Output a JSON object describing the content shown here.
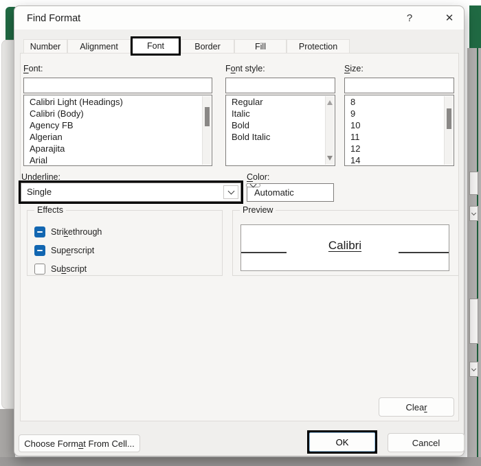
{
  "window": {
    "title": "Find Format",
    "help_icon": "?",
    "close_icon": "✕"
  },
  "tabs": {
    "items": [
      "Number",
      "Alignment",
      "Font",
      "Border",
      "Fill",
      "Protection"
    ],
    "selected": "Font"
  },
  "font_section": {
    "label": {
      "pre": "",
      "accel": "F",
      "rest": "ont:"
    },
    "input_value": "",
    "items": [
      "Calibri Light (Headings)",
      "Calibri (Body)",
      "Agency FB",
      "Algerian",
      "Aparajita",
      "Arial"
    ]
  },
  "style_section": {
    "label": {
      "pre": "F",
      "accel": "o",
      "rest": "nt style:"
    },
    "input_value": "",
    "items": [
      "Regular",
      "Italic",
      "Bold",
      "Bold Italic"
    ]
  },
  "size_section": {
    "label": {
      "pre": "",
      "accel": "S",
      "rest": "ize:"
    },
    "input_value": "",
    "items": [
      "8",
      "9",
      "10",
      "11",
      "12",
      "14"
    ]
  },
  "underline_section": {
    "label": {
      "pre": "",
      "accel": "U",
      "rest": "nderline:"
    },
    "value": "Single"
  },
  "color_section": {
    "label": {
      "pre": "",
      "accel": "C",
      "rest": "olor:"
    },
    "value": "Automatic"
  },
  "effects": {
    "title": "Effects",
    "items": [
      {
        "pre": "Stri",
        "accel": "k",
        "rest": "ethrough",
        "state": "mixed"
      },
      {
        "pre": "Sup",
        "accel": "e",
        "rest": "rscript",
        "state": "mixed"
      },
      {
        "pre": "Su",
        "accel": "b",
        "rest": "script",
        "state": "unchecked"
      }
    ]
  },
  "preview": {
    "title": "Preview",
    "text": "Calibri"
  },
  "buttons": {
    "clear": {
      "pre": "Clea",
      "accel": "r",
      "rest": ""
    },
    "choose_format": {
      "pre": "Choose Form",
      "accel": "a",
      "rest": "t From Cell..."
    },
    "ok": "OK",
    "cancel": "Cancel"
  },
  "colors": {
    "excel_green": "#206a43",
    "checkbox_blue": "#1266b1",
    "highlight_border": "#000000",
    "ok_focus_border": "#9cc7e8"
  }
}
